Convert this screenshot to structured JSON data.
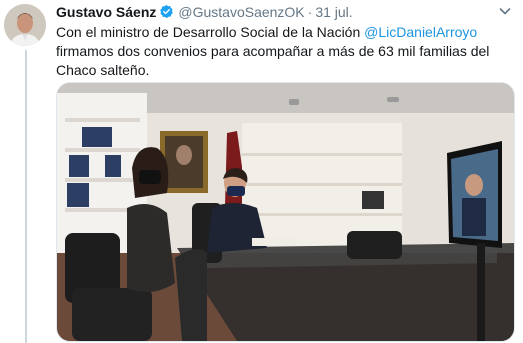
{
  "tweet": {
    "author_name": "Gustavo Sáenz",
    "handle": "@GustavoSaenzOK",
    "separator": "·",
    "date": "31 jul.",
    "text_part1": "Con el ministro de Desarrollo Social de la Nación ",
    "mention": "@LicDanielArroyo",
    "text_part2": " firmamos dos convenios para acompañar a más de 63 mil familias del Chaco salteño."
  },
  "icons": {
    "verified": "verified-badge-icon",
    "more": "chevron-down-icon"
  },
  "colors": {
    "link": "#1b95e0",
    "secondary_text": "#657786",
    "verified": "#1da1f2",
    "primary_text": "#14171a"
  }
}
